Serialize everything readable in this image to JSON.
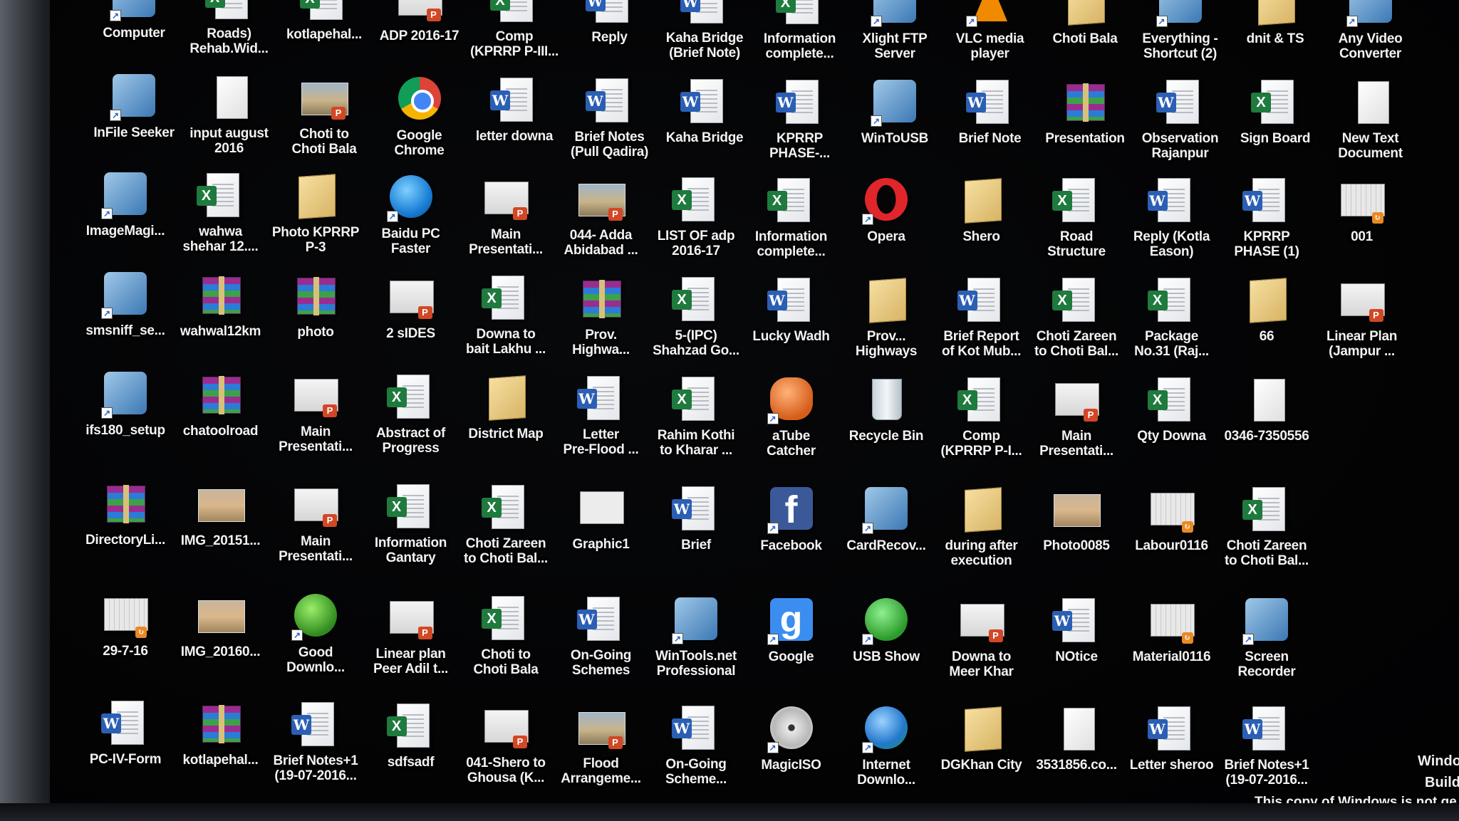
{
  "desktop": {
    "rows": [
      [
        {
          "label": "Computer",
          "type": "app",
          "icon": "computer-icon"
        },
        {
          "label": "Roads)\nRehab.Wid...",
          "type": "excel",
          "icon": "excel-icon"
        },
        {
          "label": "kotlapehal...",
          "type": "excel",
          "icon": "excel-icon"
        },
        {
          "label": "ADP 2016-17",
          "type": "ppt",
          "icon": "powerpoint-icon"
        },
        {
          "label": "Comp\n(KPRRP P-III...",
          "type": "excel",
          "icon": "excel-icon"
        },
        {
          "label": "Reply",
          "type": "word",
          "icon": "word-icon"
        },
        {
          "label": "Kaha Bridge\n(Brief Note)",
          "type": "word",
          "icon": "word-icon"
        },
        {
          "label": "Information\ncomplete...",
          "type": "excel",
          "icon": "excel-icon"
        },
        {
          "label": "Xlight FTP\nServer",
          "type": "app",
          "icon": "ftp-server-icon"
        },
        {
          "label": "VLC media\nplayer",
          "type": "vlc",
          "icon": "vlc-icon"
        },
        {
          "label": "Choti Bala",
          "type": "folder",
          "icon": "folder-icon"
        },
        {
          "label": "Everything -\nShortcut (2)",
          "type": "app",
          "icon": "search-app-icon"
        },
        {
          "label": "dnit & TS",
          "type": "folder",
          "icon": "folder-icon"
        },
        {
          "label": "Any Video\nConverter",
          "type": "app",
          "icon": "video-converter-icon"
        }
      ],
      [
        {
          "label": "InFile Seeker",
          "type": "app",
          "icon": "file-seeker-icon"
        },
        {
          "label": "input august\n2016",
          "type": "plain",
          "icon": "document-icon"
        },
        {
          "label": "Choti to\nChoti Bala",
          "type": "pptphoto",
          "icon": "powerpoint-icon"
        },
        {
          "label": "Google\nChrome",
          "type": "chrome",
          "icon": "chrome-icon"
        },
        {
          "label": "letter downa",
          "type": "word",
          "icon": "word-icon"
        },
        {
          "label": "Brief Notes\n(Pull Qadira)",
          "type": "word",
          "icon": "word-icon"
        },
        {
          "label": "Kaha Bridge",
          "type": "word",
          "icon": "word-icon"
        },
        {
          "label": "KPRRP\nPHASE-...",
          "type": "word",
          "icon": "word-icon"
        },
        {
          "label": "WinToUSB",
          "type": "app",
          "icon": "wintousb-icon"
        },
        {
          "label": "Brief Note",
          "type": "word",
          "icon": "word-icon"
        },
        {
          "label": "Presentation",
          "type": "rar",
          "icon": "winrar-icon"
        },
        {
          "label": "Observation\nRajanpur",
          "type": "word",
          "icon": "word-icon"
        },
        {
          "label": "Sign Board",
          "type": "excel",
          "icon": "excel-icon"
        },
        {
          "label": "New Text\nDocument",
          "type": "plain",
          "icon": "text-document-icon"
        }
      ],
      [
        {
          "label": "ImageMagi...",
          "type": "app",
          "icon": "imagemagick-icon"
        },
        {
          "label": "wahwa\nshehar 12....",
          "type": "excel",
          "icon": "excel-icon"
        },
        {
          "label": "Photo KPRRP\nP-3",
          "type": "folder",
          "icon": "folder-icon"
        },
        {
          "label": "Baidu PC\nFaster",
          "type": "baidu",
          "icon": "baidu-icon"
        },
        {
          "label": "Main\nPresentati...",
          "type": "ppt",
          "icon": "powerpoint-icon"
        },
        {
          "label": "044- Adda\nAbidabad ...",
          "type": "pptphoto",
          "icon": "powerpoint-icon"
        },
        {
          "label": "LIST OF adp\n2016-17",
          "type": "excel",
          "icon": "excel-icon"
        },
        {
          "label": "Information\ncomplete...",
          "type": "excel",
          "icon": "excel-icon"
        },
        {
          "label": "Opera",
          "type": "opera",
          "icon": "opera-icon"
        },
        {
          "label": "Shero",
          "type": "folder",
          "icon": "folder-icon"
        },
        {
          "label": "Road\nStructure",
          "type": "excel",
          "icon": "excel-icon"
        },
        {
          "label": "Reply (Kotla\nEason)",
          "type": "word",
          "icon": "word-icon"
        },
        {
          "label": "KPRRP\nPHASE (1)",
          "type": "word",
          "icon": "word-icon"
        },
        {
          "label": "001",
          "type": "img",
          "icon": "image-icon"
        }
      ],
      [
        {
          "label": "smsniff_se...",
          "type": "app",
          "icon": "setup-disc-icon"
        },
        {
          "label": "wahwal12km",
          "type": "rar",
          "icon": "winrar-icon"
        },
        {
          "label": "photo",
          "type": "rar",
          "icon": "winrar-icon"
        },
        {
          "label": "2 sIDES",
          "type": "ppt",
          "icon": "powerpoint-icon"
        },
        {
          "label": "Downa to\nbait Lakhu ...",
          "type": "excel",
          "icon": "excel-icon"
        },
        {
          "label": "Prov.\nHighwa...",
          "type": "rar",
          "icon": "winrar-icon"
        },
        {
          "label": "5-(IPC)\nShahzad Go...",
          "type": "excel",
          "icon": "excel-icon"
        },
        {
          "label": "Lucky Wadh",
          "type": "word",
          "icon": "word-icon"
        },
        {
          "label": "Prov...\nHighways",
          "type": "folder",
          "icon": "folder-icon"
        },
        {
          "label": "Brief Report\nof Kot Mub...",
          "type": "word",
          "icon": "word-icon"
        },
        {
          "label": "Choti Zareen\nto Choti Bal...",
          "type": "excel",
          "icon": "excel-icon"
        },
        {
          "label": "Package\nNo.31 (Raj...",
          "type": "excel",
          "icon": "excel-icon"
        },
        {
          "label": "66",
          "type": "folder",
          "icon": "folder-icon"
        },
        {
          "label": "Linear Plan\n(Jampur ...",
          "type": "ppt",
          "icon": "powerpoint-icon"
        }
      ],
      [
        {
          "label": "ifs180_setup",
          "type": "app",
          "icon": "setup-icon"
        },
        {
          "label": "chatoolroad",
          "type": "rar",
          "icon": "winrar-icon"
        },
        {
          "label": "Main\nPresentati...",
          "type": "ppt",
          "icon": "powerpoint-icon"
        },
        {
          "label": "Abstract of\nProgress",
          "type": "excel",
          "icon": "excel-icon"
        },
        {
          "label": "District Map",
          "type": "folder",
          "icon": "folder-icon"
        },
        {
          "label": "Letter\nPre-Flood ...",
          "type": "word",
          "icon": "word-icon"
        },
        {
          "label": "Rahim Kothi\nto Kharar ...",
          "type": "excel",
          "icon": "excel-icon"
        },
        {
          "label": "aTube\nCatcher",
          "type": "atube",
          "icon": "atube-catcher-icon"
        },
        {
          "label": "Recycle Bin",
          "type": "bin",
          "icon": "recycle-bin-icon"
        },
        {
          "label": "Comp\n(KPRRP P-I...",
          "type": "excel",
          "icon": "excel-icon"
        },
        {
          "label": "Main\nPresentati...",
          "type": "ppt",
          "icon": "powerpoint-icon"
        },
        {
          "label": "Qty Downa",
          "type": "excel",
          "icon": "excel-icon"
        },
        {
          "label": "0346-7350556",
          "type": "plain",
          "icon": "document-icon"
        }
      ],
      [
        {
          "label": "DirectoryLi...",
          "type": "rar",
          "icon": "winrar-icon"
        },
        {
          "label": "IMG_20151...",
          "type": "photo",
          "icon": "photo-icon"
        },
        {
          "label": "Main\nPresentati...",
          "type": "ppt",
          "icon": "powerpoint-icon"
        },
        {
          "label": "Information\nGantary",
          "type": "excel",
          "icon": "excel-icon"
        },
        {
          "label": "Choti Zareen\nto Choti Bal...",
          "type": "excel",
          "icon": "excel-icon"
        },
        {
          "label": "Graphic1",
          "type": "slideplain",
          "icon": "graphic-icon"
        },
        {
          "label": "Brief",
          "type": "word",
          "icon": "word-icon"
        },
        {
          "label": "Facebook",
          "type": "facebook",
          "icon": "facebook-icon"
        },
        {
          "label": "CardRecov...",
          "type": "app",
          "icon": "card-recovery-icon"
        },
        {
          "label": "during after\nexecution",
          "type": "folder",
          "icon": "folder-icon"
        },
        {
          "label": "Photo0085",
          "type": "photo",
          "icon": "photo-icon"
        },
        {
          "label": "Labour0116",
          "type": "img",
          "icon": "image-icon"
        },
        {
          "label": "Choti Zareen\nto Choti Bal...",
          "type": "excel",
          "icon": "excel-icon"
        }
      ],
      [
        {
          "label": "29-7-16",
          "type": "img",
          "icon": "image-icon"
        },
        {
          "label": "IMG_20160...",
          "type": "photo",
          "icon": "photo-icon"
        },
        {
          "label": "Good\nDownlo...",
          "type": "gooddl",
          "icon": "download-icon"
        },
        {
          "label": "Linear plan\nPeer Adil t...",
          "type": "ppt",
          "icon": "powerpoint-icon"
        },
        {
          "label": "Choti to\nChoti Bala",
          "type": "excel",
          "icon": "excel-icon"
        },
        {
          "label": "On-Going\nSchemes",
          "type": "word",
          "icon": "word-icon"
        },
        {
          "label": "WinTools.net\nProfessional",
          "type": "app",
          "icon": "wintools-icon"
        },
        {
          "label": "Google",
          "type": "google",
          "icon": "google-icon"
        },
        {
          "label": "USB Show",
          "type": "usbshow",
          "icon": "usb-show-icon"
        },
        {
          "label": "Downa to\nMeer Khar",
          "type": "ppt",
          "icon": "powerpoint-icon"
        },
        {
          "label": "NOtice",
          "type": "word",
          "icon": "word-icon"
        },
        {
          "label": "Material0116",
          "type": "img",
          "icon": "image-icon"
        },
        {
          "label": "Screen\nRecorder",
          "type": "app",
          "icon": "screen-recorder-icon"
        }
      ],
      [
        {
          "label": "PC-IV-Form",
          "type": "word",
          "icon": "word-icon"
        },
        {
          "label": "kotlapehal...",
          "type": "rar",
          "icon": "winrar-icon"
        },
        {
          "label": "Brief Notes+1\n(19-07-2016...",
          "type": "word",
          "icon": "word-icon"
        },
        {
          "label": "sdfsadf",
          "type": "excel",
          "icon": "excel-icon"
        },
        {
          "label": "041-Shero to\nGhousa (K...",
          "type": "ppt",
          "icon": "powerpoint-icon"
        },
        {
          "label": "Flood\nArrangeme...",
          "type": "pptphoto",
          "icon": "powerpoint-icon"
        },
        {
          "label": "On-Going\nScheme...",
          "type": "word",
          "icon": "word-icon"
        },
        {
          "label": "MagicISO",
          "type": "disc",
          "icon": "magiciso-icon"
        },
        {
          "label": "Internet\nDownlo...",
          "type": "idm",
          "icon": "internet-download-manager-icon"
        },
        {
          "label": "DGKhan City",
          "type": "folder",
          "icon": "folder-icon"
        },
        {
          "label": "3531856.co...",
          "type": "plain",
          "icon": "document-icon"
        },
        {
          "label": "Letter sheroo",
          "type": "word",
          "icon": "word-icon"
        },
        {
          "label": "Brief Notes+1\n(19-07-2016...",
          "type": "word",
          "icon": "word-icon"
        }
      ]
    ],
    "watermark": {
      "line1": "Windo",
      "line2": "Build",
      "line3": "This copy of Windows is not ge"
    },
    "colors": {
      "background": "#050506",
      "label_text": "#f2f2f2",
      "word": "#2b5fb4",
      "excel": "#1f7a3e",
      "powerpoint": "#d24726",
      "folder": "#e8c87c"
    }
  }
}
